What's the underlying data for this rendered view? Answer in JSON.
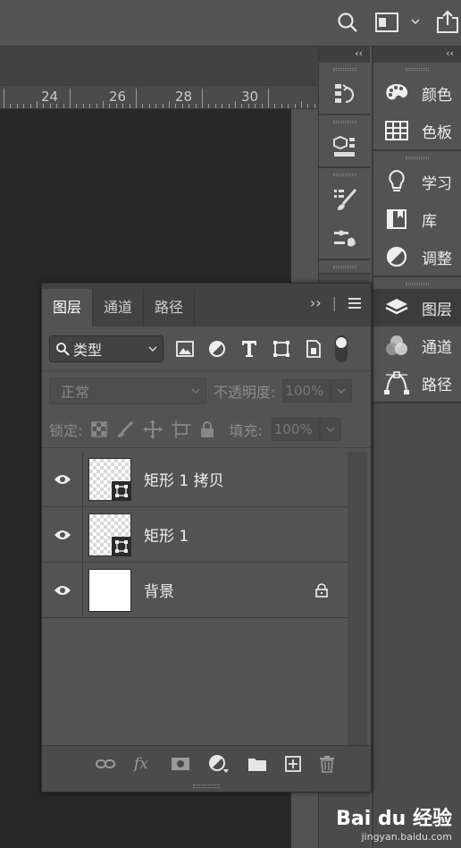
{
  "colors": {
    "bg": "#535353",
    "canvas": "#282828",
    "panel_dark": "#424242",
    "active_row": "#3c3c3c",
    "text": "#e8e8e8"
  },
  "topbar": {
    "icons": [
      "search-icon",
      "workspace-icon",
      "chevron-down-icon",
      "share-icon"
    ]
  },
  "ruler": {
    "labels": [
      "24",
      "26",
      "28",
      "30"
    ]
  },
  "dock": {
    "collapse_label": "‹‹",
    "buttons": [
      "history-icon",
      "3d-icon",
      "brush-settings-icon",
      "brush-presets-icon"
    ]
  },
  "right_panels": {
    "collapse_label": "‹‹",
    "groups": [
      {
        "items": [
          {
            "icon": "palette-icon",
            "label": "颜色"
          },
          {
            "icon": "swatches-icon",
            "label": "色板"
          }
        ]
      },
      {
        "items": [
          {
            "icon": "lightbulb-icon",
            "label": "学习"
          },
          {
            "icon": "library-icon",
            "label": "库"
          },
          {
            "icon": "adjust-icon",
            "label": "调整"
          }
        ]
      },
      {
        "items": [
          {
            "icon": "layers-icon",
            "label": "图层",
            "active": true
          },
          {
            "icon": "channels-icon",
            "label": "通道"
          },
          {
            "icon": "paths-icon",
            "label": "路径"
          }
        ]
      }
    ]
  },
  "layers_panel": {
    "tabs": [
      "图层",
      "通道",
      "路径"
    ],
    "active_tab": "图层",
    "expand_label": "››",
    "filter": {
      "selected": "类型"
    },
    "blend": {
      "mode": "正常",
      "opacity_label": "不透明度:",
      "opacity_value": "100%"
    },
    "lock": {
      "label": "锁定:",
      "fill_label": "填充:",
      "fill_value": "100%"
    },
    "layers": [
      {
        "name": "矩形 1 拷贝",
        "thumb": "shape",
        "locked": false
      },
      {
        "name": "矩形 1",
        "thumb": "shape",
        "locked": false
      },
      {
        "name": "背景",
        "thumb": "white",
        "locked": true
      }
    ],
    "footer_icons": [
      "link-icon",
      "fx-icon",
      "mask-icon",
      "adjustment-layer-icon",
      "group-folder-icon",
      "new-layer-icon",
      "trash-icon"
    ]
  },
  "watermark": {
    "logo": "Bai du 经验",
    "url": "jingyan.baidu.com"
  }
}
